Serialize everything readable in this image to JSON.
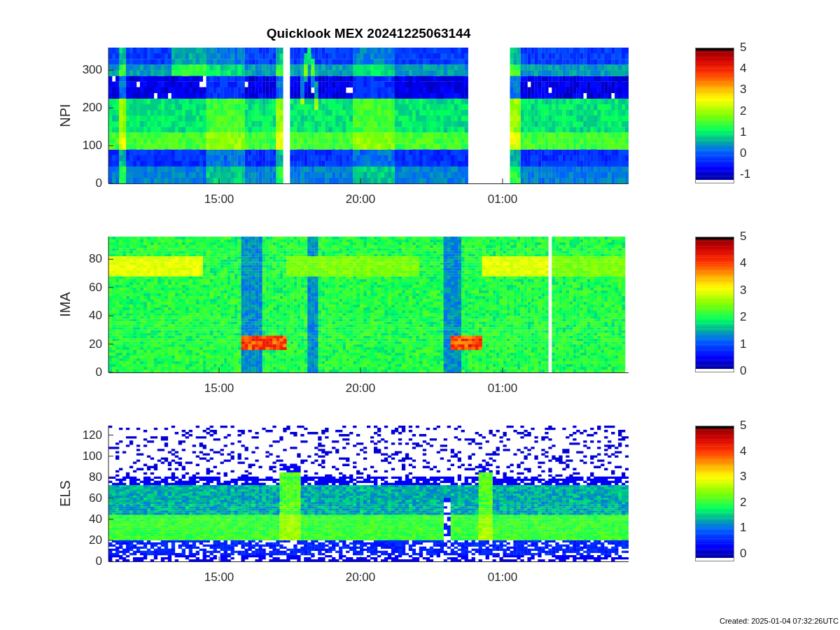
{
  "title": "Quicklook MEX 20241225063144",
  "panels": [
    {
      "ylabel": "NPI",
      "yticks": [
        "300",
        "200",
        "100",
        "0"
      ],
      "xticks": [
        "15:00",
        "20:00",
        "01:00"
      ],
      "colorbar_ticks": [
        "5",
        "4",
        "3",
        "2",
        "1",
        "0",
        "-1"
      ]
    },
    {
      "ylabel": "IMA",
      "yticks": [
        "80",
        "60",
        "40",
        "20",
        "0"
      ],
      "xticks": [
        "15:00",
        "20:00",
        "01:00"
      ],
      "colorbar_ticks": [
        "5",
        "4",
        "3",
        "2",
        "1",
        "0"
      ]
    },
    {
      "ylabel": "ELS",
      "yticks": [
        "120",
        "100",
        "80",
        "60",
        "40",
        "20",
        "0"
      ],
      "xticks": [
        "15:00",
        "20:00",
        "01:00"
      ],
      "colorbar_ticks": [
        "5",
        "4",
        "3",
        "2",
        "1",
        "0"
      ]
    }
  ],
  "footer": "Created: 2025-01-04 07:32:26UTC"
}
